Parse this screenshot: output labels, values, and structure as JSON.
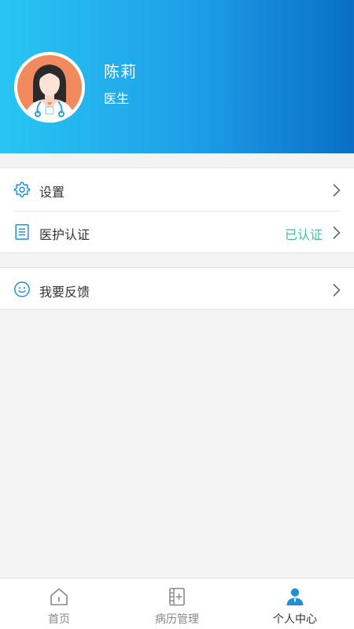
{
  "profile": {
    "name": "陈莉",
    "role": "医生"
  },
  "menu": {
    "group1": [
      {
        "label": "设置",
        "icon": "gear-icon"
      },
      {
        "label": "医护认证",
        "icon": "document-icon",
        "status": "已认证"
      }
    ],
    "group2": [
      {
        "label": "我要反馈",
        "icon": "smiley-icon"
      }
    ]
  },
  "tabs": [
    {
      "label": "首页",
      "icon": "home-icon",
      "active": false
    },
    {
      "label": "病历管理",
      "icon": "records-icon",
      "active": false
    },
    {
      "label": "个人中心",
      "icon": "person-icon",
      "active": true
    }
  ],
  "colors": {
    "header_gradient_start": "#29c5f2",
    "header_gradient_end": "#0a6fc4",
    "accent_blue": "#1e8fd8",
    "verified_green": "#3fc0a3"
  }
}
